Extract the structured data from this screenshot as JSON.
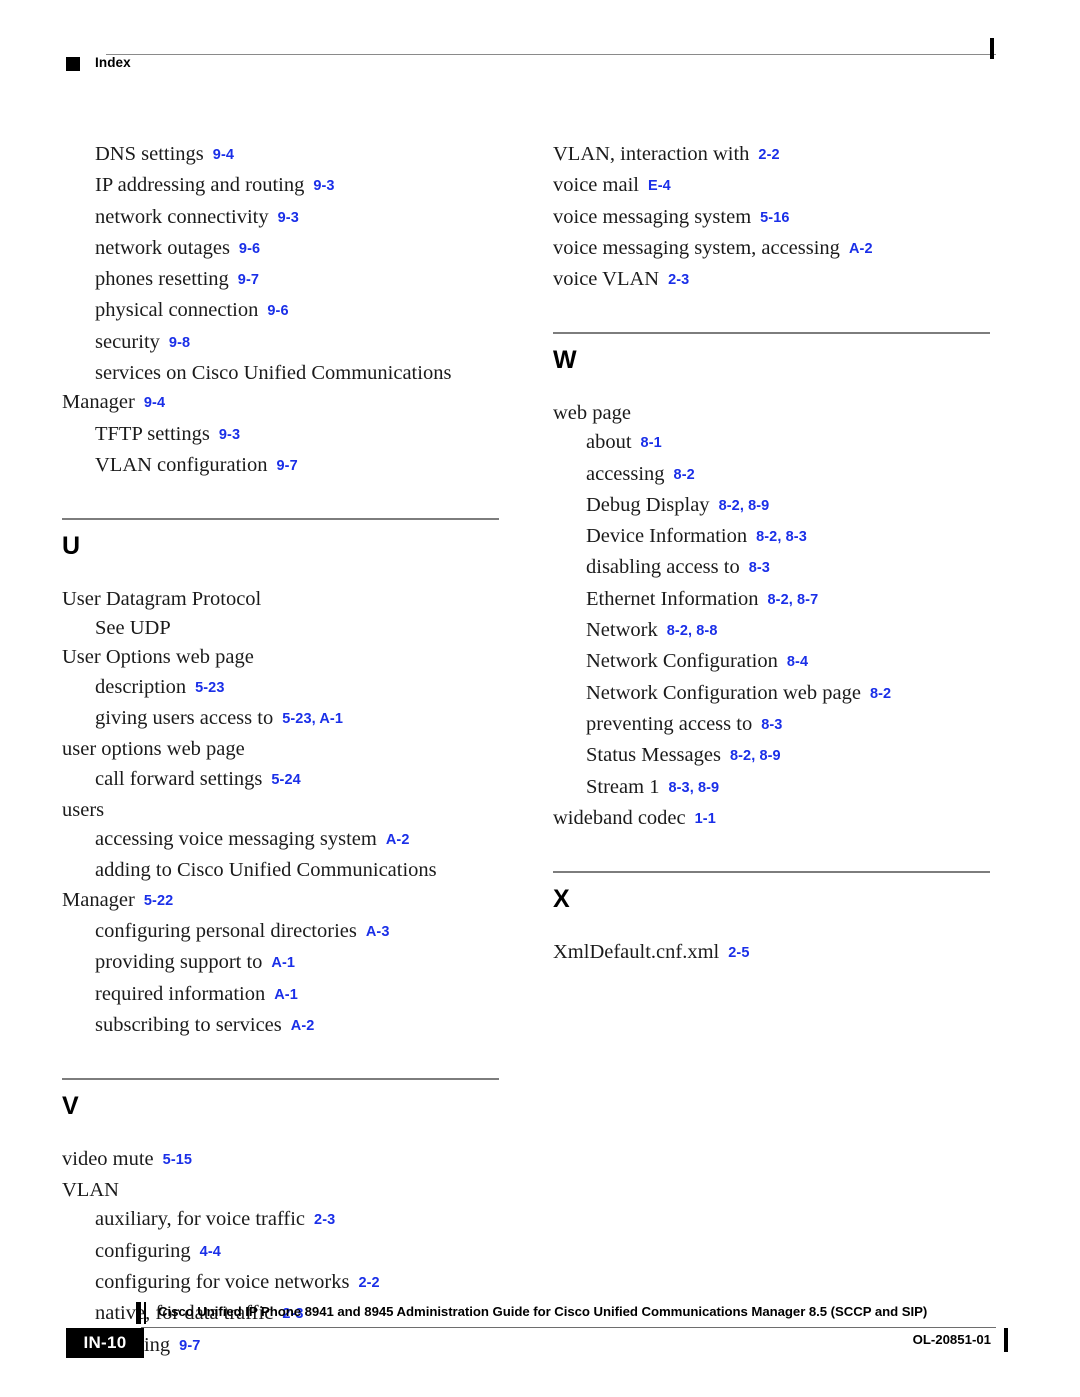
{
  "header": {
    "title": "Index",
    "marker_icon": "black-square-icon"
  },
  "footer": {
    "guide_title": "Cisco Unified IP Phone 8941 and 8945 Administration Guide for Cisco Unified Communications Manager 8.5 (SCCP and SIP)",
    "page_number": "IN-10",
    "doc_number": "OL-20851-01"
  },
  "colors": {
    "reference_blue": "#1a2fe8",
    "text_black": "#1b1b1b",
    "rule_gray": "#7d7d7d"
  },
  "columns": {
    "left": {
      "continued_entries": [
        {
          "level": 1,
          "term": "DNS settings",
          "ref": "9-4"
        },
        {
          "level": 1,
          "term": "IP addressing and routing",
          "ref": "9-3"
        },
        {
          "level": 1,
          "term": "network connectivity",
          "ref": "9-3"
        },
        {
          "level": 1,
          "term": "network outages",
          "ref": "9-6"
        },
        {
          "level": 1,
          "term": "phones resetting",
          "ref": "9-7"
        },
        {
          "level": 1,
          "term": "physical connection",
          "ref": "9-6"
        },
        {
          "level": 1,
          "term": "security",
          "ref": "9-8"
        },
        {
          "level": 1,
          "term": "services on Cisco Unified Communications",
          "term2": "Manager",
          "ref": "9-4",
          "wrapped": true
        },
        {
          "level": 1,
          "term": "TFTP settings",
          "ref": "9-3"
        },
        {
          "level": 1,
          "term": "VLAN configuration",
          "ref": "9-7"
        }
      ],
      "sections": [
        {
          "letter": "U",
          "entries": [
            {
              "level": 0,
              "term": "User Datagram Protocol",
              "ref": ""
            },
            {
              "level": 1,
              "term": "See UDP",
              "ref": ""
            },
            {
              "level": 0,
              "term": "User Options web page",
              "ref": ""
            },
            {
              "level": 1,
              "term": "description",
              "ref": "5-23"
            },
            {
              "level": 1,
              "term": "giving users access to",
              "ref": "5-23, A-1"
            },
            {
              "level": 0,
              "term": "user options web page",
              "ref": ""
            },
            {
              "level": 1,
              "term": "call forward settings",
              "ref": "5-24"
            },
            {
              "level": 0,
              "term": "users",
              "ref": ""
            },
            {
              "level": 1,
              "term": "accessing voice messaging system",
              "ref": "A-2"
            },
            {
              "level": 1,
              "term": "adding to Cisco Unified Communications",
              "term2": "Manager",
              "ref": "5-22",
              "wrapped": true
            },
            {
              "level": 1,
              "term": "configuring personal directories",
              "ref": "A-3"
            },
            {
              "level": 1,
              "term": "providing support to",
              "ref": "A-1"
            },
            {
              "level": 1,
              "term": "required information",
              "ref": "A-1"
            },
            {
              "level": 1,
              "term": "subscribing to services",
              "ref": "A-2"
            }
          ]
        },
        {
          "letter": "V",
          "entries": [
            {
              "level": 0,
              "term": "video mute",
              "ref": "5-15"
            },
            {
              "level": 0,
              "term": "VLAN",
              "ref": ""
            },
            {
              "level": 1,
              "term": "auxiliary, for voice traffic",
              "ref": "2-3"
            },
            {
              "level": 1,
              "term": "configuring",
              "ref": "4-4"
            },
            {
              "level": 1,
              "term": "configuring for voice networks",
              "ref": "2-2"
            },
            {
              "level": 1,
              "term": "native, for data traffic",
              "ref": "2-3"
            },
            {
              "level": 1,
              "term": "verifying",
              "ref": "9-7"
            }
          ]
        }
      ]
    },
    "right": {
      "continued_entries": [
        {
          "level": 0,
          "term": "VLAN, interaction with",
          "ref": "2-2"
        },
        {
          "level": 0,
          "term": "voice mail",
          "ref": "E-4"
        },
        {
          "level": 0,
          "term": "voice messaging system",
          "ref": "5-16"
        },
        {
          "level": 0,
          "term": "voice messaging system, accessing",
          "ref": "A-2"
        },
        {
          "level": 0,
          "term": "voice VLAN",
          "ref": "2-3"
        }
      ],
      "sections": [
        {
          "letter": "W",
          "entries": [
            {
              "level": 0,
              "term": "web page",
              "ref": ""
            },
            {
              "level": 1,
              "term": "about",
              "ref": "8-1"
            },
            {
              "level": 1,
              "term": "accessing",
              "ref": "8-2"
            },
            {
              "level": 1,
              "term": "Debug Display",
              "ref": "8-2, 8-9"
            },
            {
              "level": 1,
              "term": "Device Information",
              "ref": "8-2, 8-3"
            },
            {
              "level": 1,
              "term": "disabling access to",
              "ref": "8-3"
            },
            {
              "level": 1,
              "term": "Ethernet Information",
              "ref": "8-2, 8-7"
            },
            {
              "level": 1,
              "term": "Network",
              "ref": "8-2, 8-8"
            },
            {
              "level": 1,
              "term": "Network Configuration",
              "ref": "8-4"
            },
            {
              "level": 1,
              "term": "Network Configuration web page",
              "ref": "8-2"
            },
            {
              "level": 1,
              "term": "preventing access to",
              "ref": "8-3"
            },
            {
              "level": 1,
              "term": "Status Messages",
              "ref": "8-2, 8-9"
            },
            {
              "level": 1,
              "term": "Stream 1",
              "ref": "8-3, 8-9"
            },
            {
              "level": 0,
              "term": "wideband codec",
              "ref": "1-1"
            }
          ]
        },
        {
          "letter": "X",
          "entries": [
            {
              "level": 0,
              "term": "XmlDefault.cnf.xml",
              "ref": "2-5"
            }
          ]
        }
      ]
    }
  }
}
